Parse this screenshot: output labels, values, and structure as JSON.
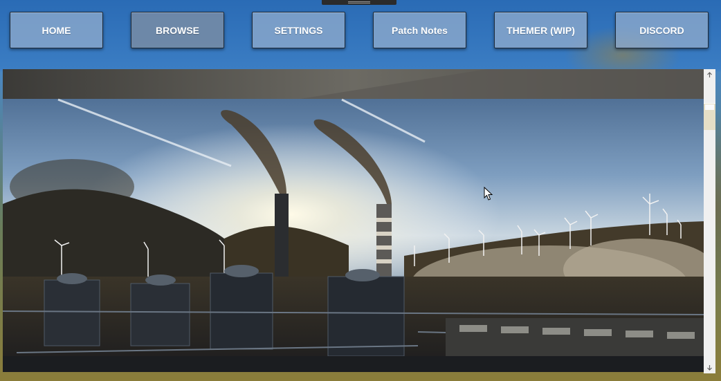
{
  "nav": {
    "items": [
      {
        "label": "HOME"
      },
      {
        "label": "BROWSE"
      },
      {
        "label": "SETTINGS"
      },
      {
        "label": "Patch Notes"
      },
      {
        "label": "THEMER (WIP)"
      },
      {
        "label": "DISCORD"
      }
    ],
    "active": "BROWSE"
  },
  "scrollbar": {
    "up_icon": "arrow-up-icon",
    "down_icon": "arrow-down-icon"
  },
  "colors": {
    "button_bg": "#96afcd",
    "button_text": "#ffffff",
    "scrollbar_bg": "#f0f0f0"
  }
}
